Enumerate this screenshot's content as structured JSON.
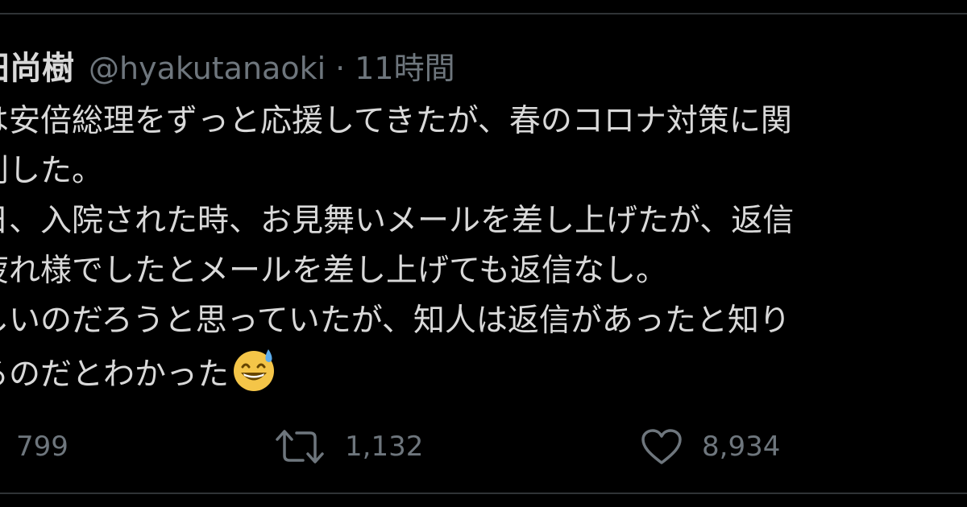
{
  "tweet": {
    "display_name": "田尚樹",
    "handle": "@hyakutanaoki",
    "separator": "·",
    "time": "11時間",
    "lines": [
      "は安倍総理をずっと応援してきたが、春のコロナ対策に関",
      "判した。",
      "日、入院された時、お見舞いメールを差し上げたが、返信",
      "疲れ様でしたとメールを差し上げても返信なし。",
      "しいのだろうと思っていたが、知人は返信があったと知り",
      "るのだとわかった"
    ],
    "emoji": "grinning-face-with-sweat-icon"
  },
  "actions": {
    "reply_count": "799",
    "retweet_count": "1,132",
    "like_count": "8,934"
  },
  "colors": {
    "background": "#000000",
    "text": "#d9d9d9",
    "secondary": "#6e767d",
    "divider": "#2f3336"
  }
}
